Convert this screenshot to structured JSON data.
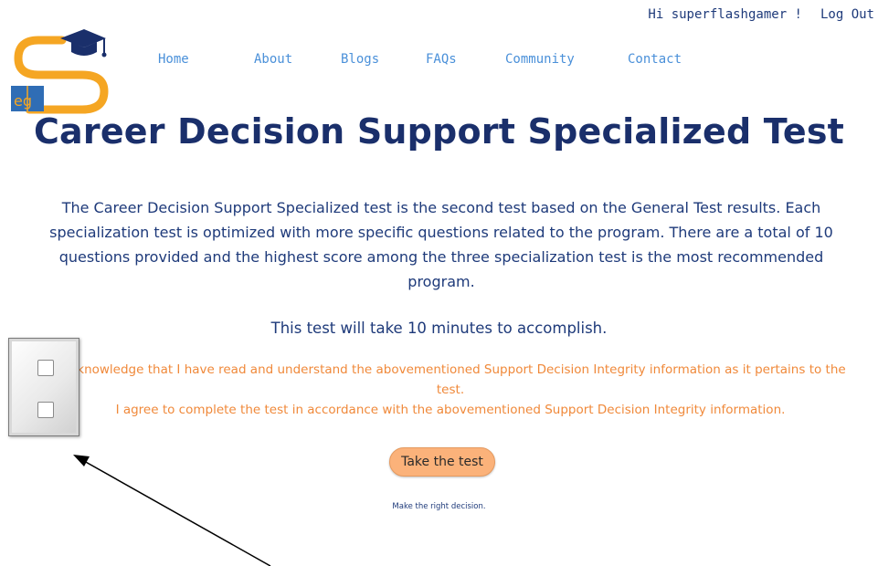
{
  "user_bar": {
    "greeting": "Hi superflashgamer !",
    "logout_label": "Log Out"
  },
  "logo": {
    "icon": "eg-graduation-logo-icon",
    "letters": "eg",
    "colors": {
      "orange": "#f5a623",
      "navy": "#1a2f6b",
      "blue": "#2f6db5"
    }
  },
  "nav": {
    "items": [
      {
        "label": "Home"
      },
      {
        "label": "About"
      },
      {
        "label": "Blogs"
      },
      {
        "label": "FAQs"
      },
      {
        "label": "Community"
      },
      {
        "label": "Contact"
      }
    ]
  },
  "main": {
    "title": "Career Decision Support Specialized Test",
    "description": "The Career Decision Support Specialized test is the second test based on the General Test results. Each specialization test is optimized with more specific questions related to the program. There are a total of 10 questions provided and the highest score among the three specialization test is the most recommended program.",
    "duration": "This test will take 10 minutes to accomplish.",
    "acknowledgements": [
      {
        "text": "I acknowledge that I have read and understand the abovementioned Support Decision Integrity information as it pertains to the test.",
        "checked": false
      },
      {
        "text": "I agree to complete the test in accordance with the abovementioned Support Decision Integrity information.",
        "checked": false
      }
    ],
    "take_test_label": "Take the test",
    "tagline": "Make the right decision."
  },
  "colors": {
    "title": "#1a2f6b",
    "nav_link": "#4a90d9",
    "acknowledgement_text": "#f0893a",
    "button": "#fbb27a"
  }
}
